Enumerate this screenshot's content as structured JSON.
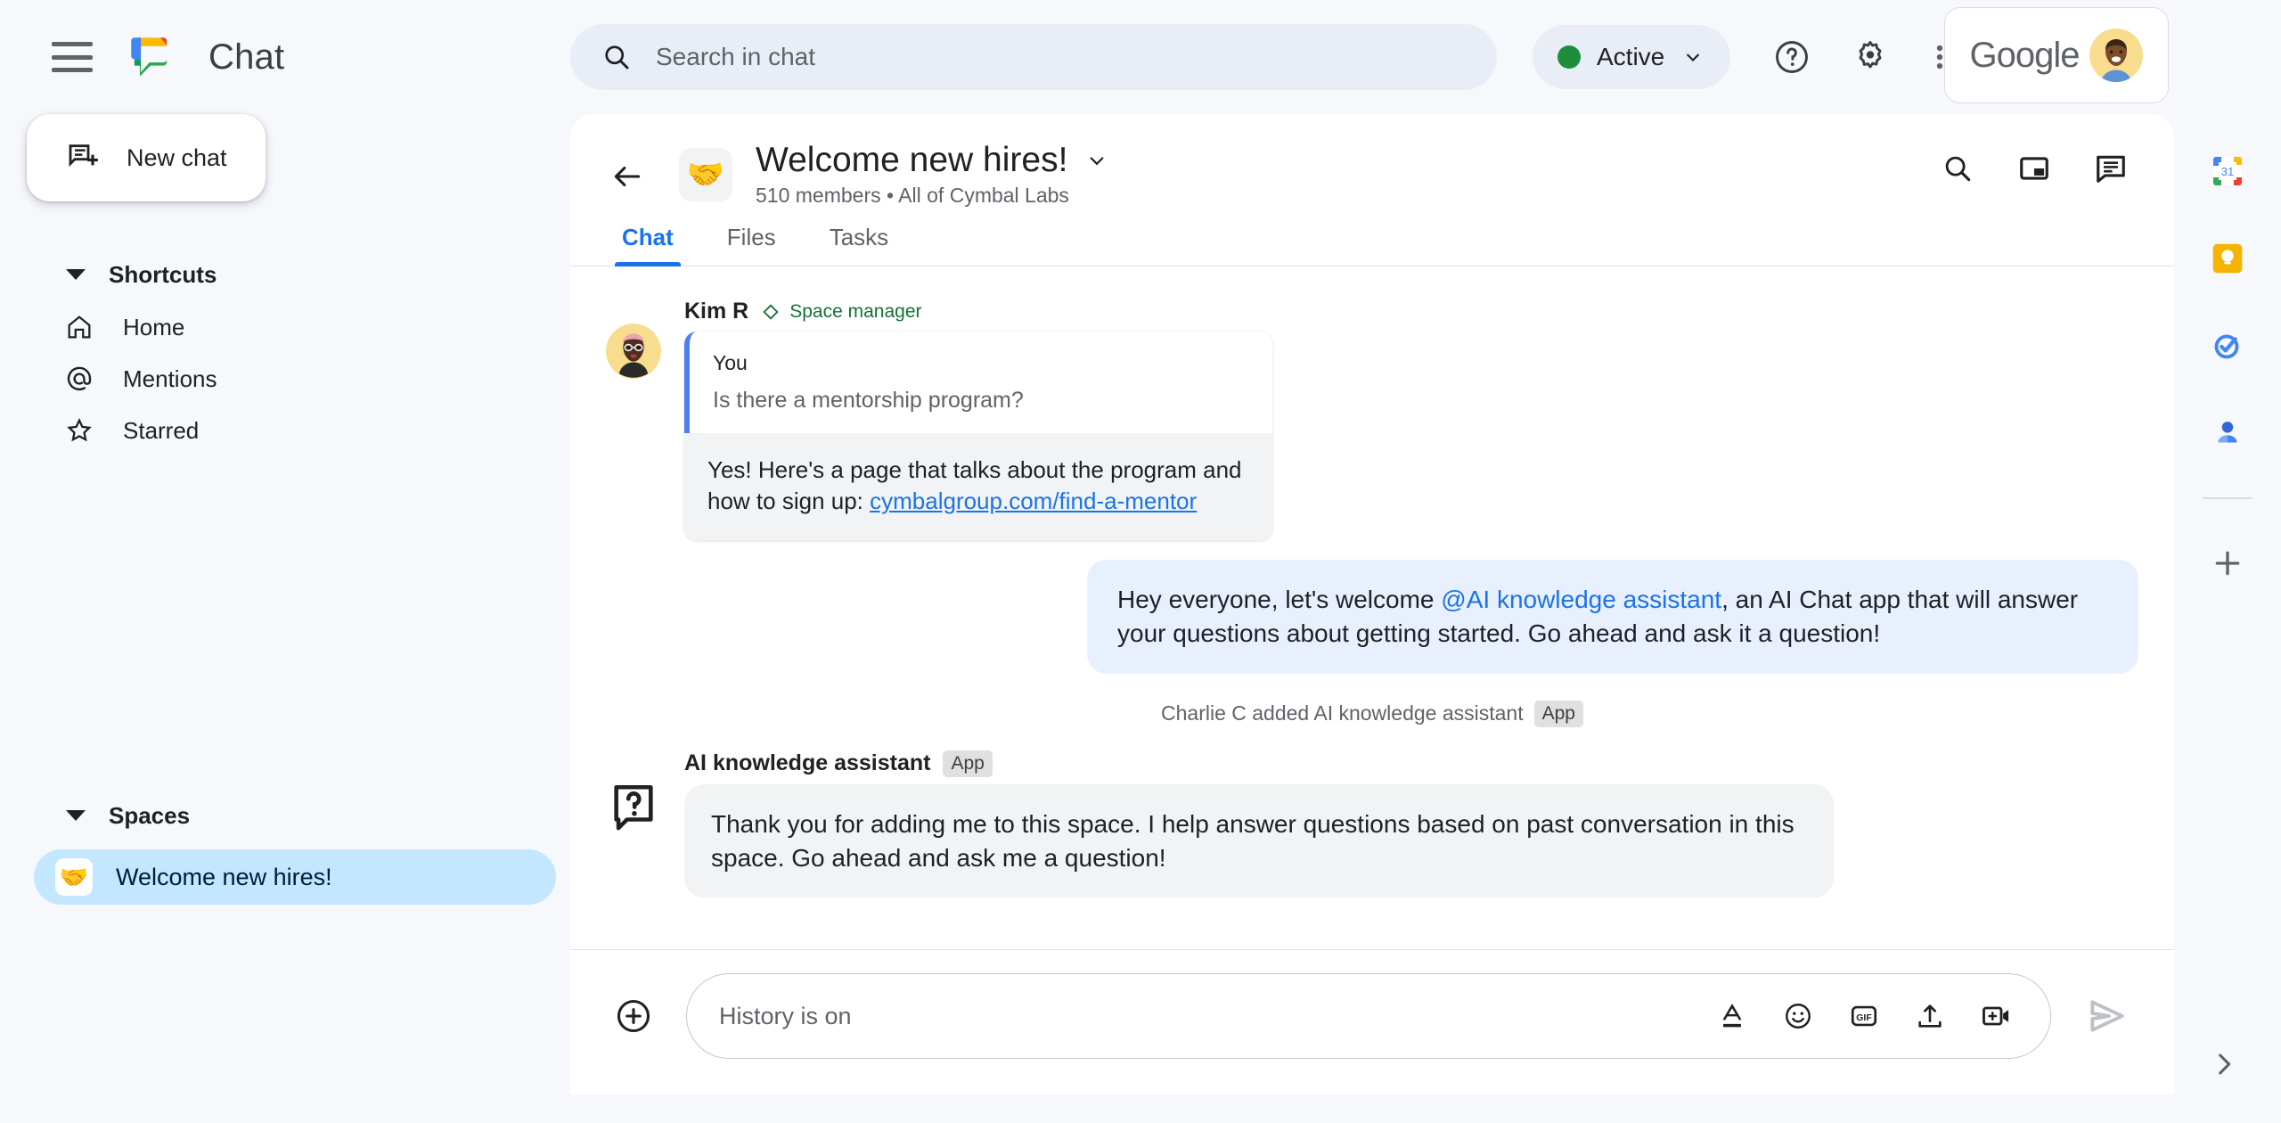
{
  "brand": {
    "app_name": "Chat",
    "menu_icon": "hamburger-menu-icon",
    "logo_icon": "google-chat-logo"
  },
  "new_chat": {
    "label": "New chat",
    "icon": "new-chat-icon"
  },
  "sidebar": {
    "shortcuts": {
      "title": "Shortcuts",
      "items": [
        {
          "label": "Home",
          "icon": "home-icon"
        },
        {
          "label": "Mentions",
          "icon": "at-sign-icon"
        },
        {
          "label": "Starred",
          "icon": "star-icon"
        }
      ]
    },
    "spaces": {
      "title": "Spaces",
      "items": [
        {
          "label": "Welcome new hires!",
          "emoji": "🤝",
          "selected": true
        }
      ]
    }
  },
  "topbar": {
    "search": {
      "placeholder": "Search in chat",
      "icon": "search-icon"
    },
    "status": {
      "label": "Active",
      "color": "#1e8e3e",
      "chevron": "chevron-down-icon"
    },
    "icons": [
      {
        "name": "help-icon"
      },
      {
        "name": "settings-gear-icon"
      },
      {
        "name": "apps-grid-icon"
      }
    ],
    "account": {
      "brand_word": "Google",
      "avatar": "user-avatar"
    }
  },
  "space": {
    "back_icon": "back-arrow-icon",
    "emoji": "🤝",
    "title": "Welcome new hires!",
    "title_chevron": "chevron-down-icon",
    "members": "510 members",
    "separator": "•",
    "org": "All of Cymbal Labs",
    "subtitle": "510 members  •  All of Cymbal Labs",
    "header_icons": [
      {
        "name": "search-in-space-icon"
      },
      {
        "name": "picture-in-picture-icon"
      },
      {
        "name": "chat-bubble-icon"
      }
    ],
    "tabs": [
      {
        "label": "Chat",
        "active": true
      },
      {
        "label": "Files",
        "active": false
      },
      {
        "label": "Tasks",
        "active": false
      }
    ]
  },
  "messages": {
    "kim": {
      "sender": "Kim R",
      "role": "Space manager",
      "role_icon": "diamond-badge-icon",
      "avatar": "kim-avatar",
      "quoted_author": "You",
      "quoted_text": "Is there a mentorship program?",
      "reply_text_before": "Yes! Here's a page that talks about the program and how to sign up: ",
      "reply_link": "cymbalgroup.com/find-a-mentor"
    },
    "welcome": {
      "text_before": "Hey everyone, let's welcome ",
      "mention": "@AI knowledge assistant",
      "text_after": ", an AI Chat app that will answer your questions about getting started.  Go ahead and ask it a question!"
    },
    "system": {
      "text": "Charlie C added AI knowledge assistant",
      "tag": "App"
    },
    "assistant": {
      "sender": "AI knowledge assistant",
      "tag": "App",
      "avatar": "question-mark-app-icon",
      "text": "Thank you for adding me to this space. I help answer questions based on past conversation in this space. Go ahead and ask me a question!"
    }
  },
  "composer": {
    "add_icon": "plus-circle-icon",
    "placeholder": "History is on",
    "icons": [
      {
        "name": "text-format-icon"
      },
      {
        "name": "emoji-icon"
      },
      {
        "name": "gif-icon"
      },
      {
        "name": "upload-icon"
      },
      {
        "name": "add-video-meeting-icon"
      }
    ],
    "send_icon": "send-icon"
  },
  "rail": {
    "items": [
      {
        "name": "google-calendar-icon"
      },
      {
        "name": "google-keep-icon"
      },
      {
        "name": "google-tasks-icon"
      },
      {
        "name": "contacts-icon"
      }
    ],
    "add_icon": "add-apps-icon",
    "expand_icon": "chevron-right-icon"
  }
}
